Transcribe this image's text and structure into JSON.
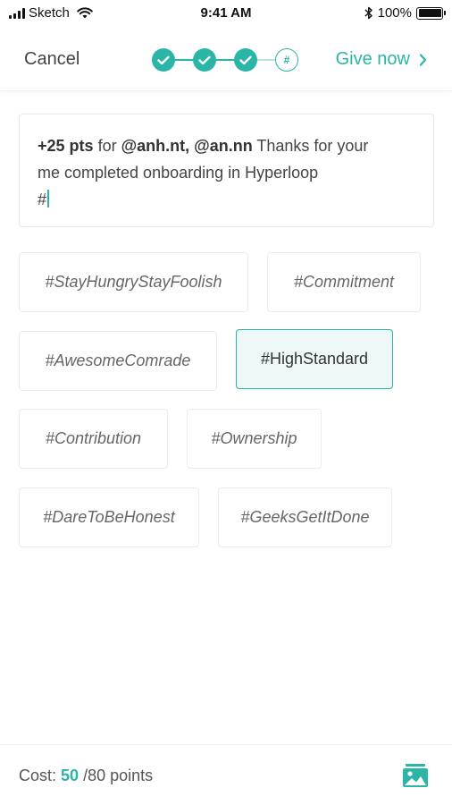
{
  "status_bar": {
    "carrier": "Sketch",
    "time": "9:41 AM",
    "battery": "100%"
  },
  "nav": {
    "cancel_label": "Cancel",
    "current_step_symbol": "#",
    "give_now_label": "Give now"
  },
  "message": {
    "points": "+25 pts",
    "for_word": "for",
    "mentions": "@anh.nt, @an.nn",
    "text_line1": "Thanks for your",
    "text_line2": "me completed onboarding in Hyperloop",
    "text_line3": "#"
  },
  "tags": [
    {
      "label": "#StayHungryStayFoolish"
    },
    {
      "label": "#Commitment"
    },
    {
      "label": "#AwesomeComrade"
    },
    {
      "label": "#HighStandard"
    },
    {
      "label": "#Contribution"
    },
    {
      "label": "#Ownership"
    },
    {
      "label": "#DareToBeHonest"
    },
    {
      "label": "#GeeksGetItDone"
    }
  ],
  "footer": {
    "cost_label": "Cost:",
    "cost_value": "50",
    "cost_total": "/80 points"
  },
  "colors": {
    "accent": "#2bb5a6",
    "selected_tag_bg": "#eef9f7"
  },
  "icons": [
    "signal-icon",
    "wifi-icon",
    "bluetooth-icon",
    "battery-icon",
    "check-icon",
    "chevron-right-icon",
    "image-icon"
  ]
}
